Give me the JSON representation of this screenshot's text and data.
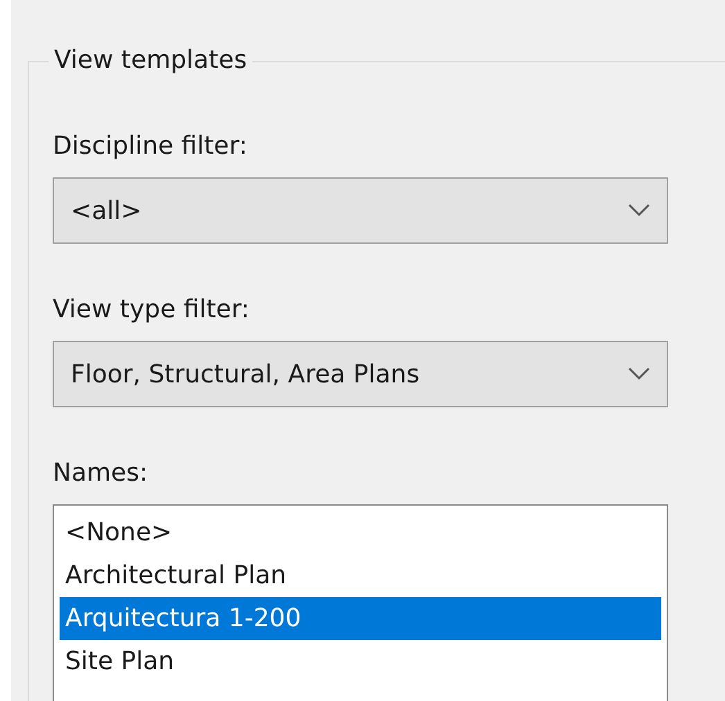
{
  "group": {
    "title": "View templates"
  },
  "discipline_filter": {
    "label": "Discipline filter:",
    "value": "<all>"
  },
  "view_type_filter": {
    "label": "View type filter:",
    "value": "Floor, Structural, Area Plans"
  },
  "names": {
    "label": "Names:",
    "items": [
      {
        "text": "<None>",
        "selected": false
      },
      {
        "text": "Architectural Plan",
        "selected": false
      },
      {
        "text": "Arquitectura 1-200",
        "selected": true
      },
      {
        "text": "Site Plan",
        "selected": false
      }
    ]
  }
}
